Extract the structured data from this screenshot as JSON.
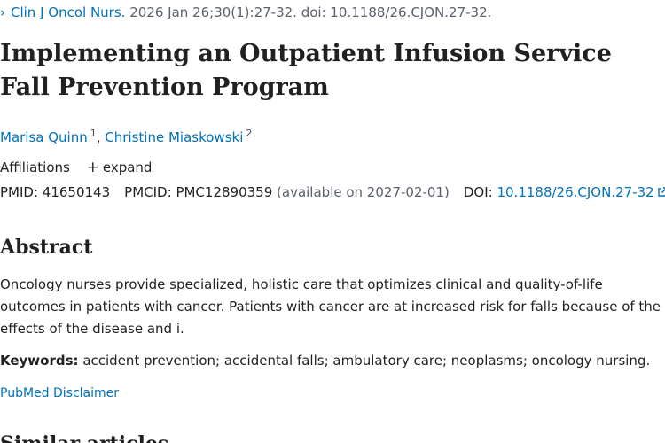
{
  "citation": {
    "chevron": "›",
    "journal": "Clin J Oncol Nurs.",
    "details": "2026 Jan 26;30(1):27-32. doi: 10.1188/26.CJON.27-32."
  },
  "article": {
    "title": "Implementing an Outpatient Infusion Service Fall Prevention Program"
  },
  "authors": [
    {
      "name": "Marisa Quinn",
      "sup": "1"
    },
    {
      "name": "Christine Miaskowski",
      "sup": "2"
    }
  ],
  "affiliations": {
    "label": "Affiliations",
    "toggle_symbol": "+",
    "toggle_label": "expand"
  },
  "identifiers": {
    "pmid_label": "PMID:",
    "pmid": "41650143",
    "pmcid_label": "PMCID:",
    "pmcid": "PMC12890359",
    "pmcid_note": "(available on 2027-02-01)",
    "doi_label": "DOI:",
    "doi": "10.1188/26.CJON.27-32"
  },
  "abstract": {
    "heading": "Abstract",
    "text": "Oncology nurses provide specialized, holistic care that optimizes clinical and quality-of-life outcomes in patients with cancer. Patients with cancer are at increased risk for falls because of the effects of the disease and i."
  },
  "keywords": {
    "label": "Keywords:",
    "text": "accident prevention; accidental falls; ambulatory care; neoplasms; oncology nursing."
  },
  "disclaimer": {
    "label": "PubMed Disclaimer"
  },
  "similar": {
    "heading": "Similar articles"
  },
  "colors": {
    "link": "#0071bc",
    "text": "#212121",
    "muted": "#5b616b"
  },
  "icons": {
    "citation_expand": "chevron-right-icon",
    "affiliations_expand": "plus-icon",
    "doi_external": "external-link-icon"
  }
}
